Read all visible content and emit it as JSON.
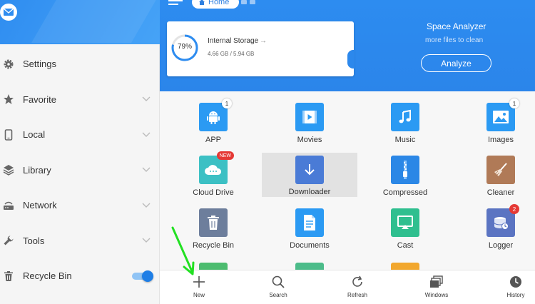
{
  "drawer": {
    "items": [
      {
        "label": "Settings",
        "icon": "gear-icon"
      },
      {
        "label": "Favorite",
        "icon": "star-icon"
      },
      {
        "label": "Local",
        "icon": "phone-icon"
      },
      {
        "label": "Library",
        "icon": "layers-icon"
      },
      {
        "label": "Network",
        "icon": "router-icon"
      },
      {
        "label": "Tools",
        "icon": "wrench-icon"
      },
      {
        "label": "Recycle Bin",
        "icon": "trash-icon",
        "toggle_on": true
      }
    ]
  },
  "header": {
    "breadcrumb_label": "Home"
  },
  "storage": {
    "percent_label": "79%",
    "percent_used": 0.79,
    "title": "Internal Storage",
    "arrow": "→",
    "size_text": "4.66 GB / 5.94 GB"
  },
  "analyzer": {
    "title": "Space Analyzer",
    "subtitle": "more files to clean",
    "button_label": "Analyze"
  },
  "grid": {
    "tiles": [
      {
        "label": "APP",
        "icon": "android-icon",
        "color": "#2b9af3",
        "badge": "1"
      },
      {
        "label": "Movies",
        "icon": "film-icon",
        "color": "#2b9af3"
      },
      {
        "label": "Music",
        "icon": "music-note-icon",
        "color": "#2b9af3"
      },
      {
        "label": "Images",
        "icon": "image-icon",
        "color": "#2b9af3",
        "badge": "1"
      },
      {
        "label": "Cloud Drive",
        "icon": "cloud-icon",
        "color": "#3cc0c4",
        "badge_new": "NEW"
      },
      {
        "label": "Downloader",
        "icon": "download-icon",
        "color": "#4a7bd6"
      },
      {
        "label": "Compressed",
        "icon": "zip-icon",
        "color": "#2b87e6"
      },
      {
        "label": "Cleaner",
        "icon": "broom-icon",
        "color": "#b07a57"
      },
      {
        "label": "Recycle Bin",
        "icon": "trash-icon",
        "color": "#6d7e9c"
      },
      {
        "label": "Documents",
        "icon": "document-icon",
        "color": "#2b9af3"
      },
      {
        "label": "Cast",
        "icon": "cast-icon",
        "color": "#2fbf8f"
      },
      {
        "label": "Logger",
        "icon": "logger-icon",
        "color": "#5b74c2",
        "badge_red": "2"
      }
    ]
  },
  "bottombar": {
    "items": [
      {
        "label": "New"
      },
      {
        "label": "Search"
      },
      {
        "label": "Refresh"
      },
      {
        "label": "Windows"
      },
      {
        "label": "History"
      }
    ]
  },
  "colors": {
    "accent": "#2d8cf0",
    "annotation_arrow": "#22e022"
  }
}
